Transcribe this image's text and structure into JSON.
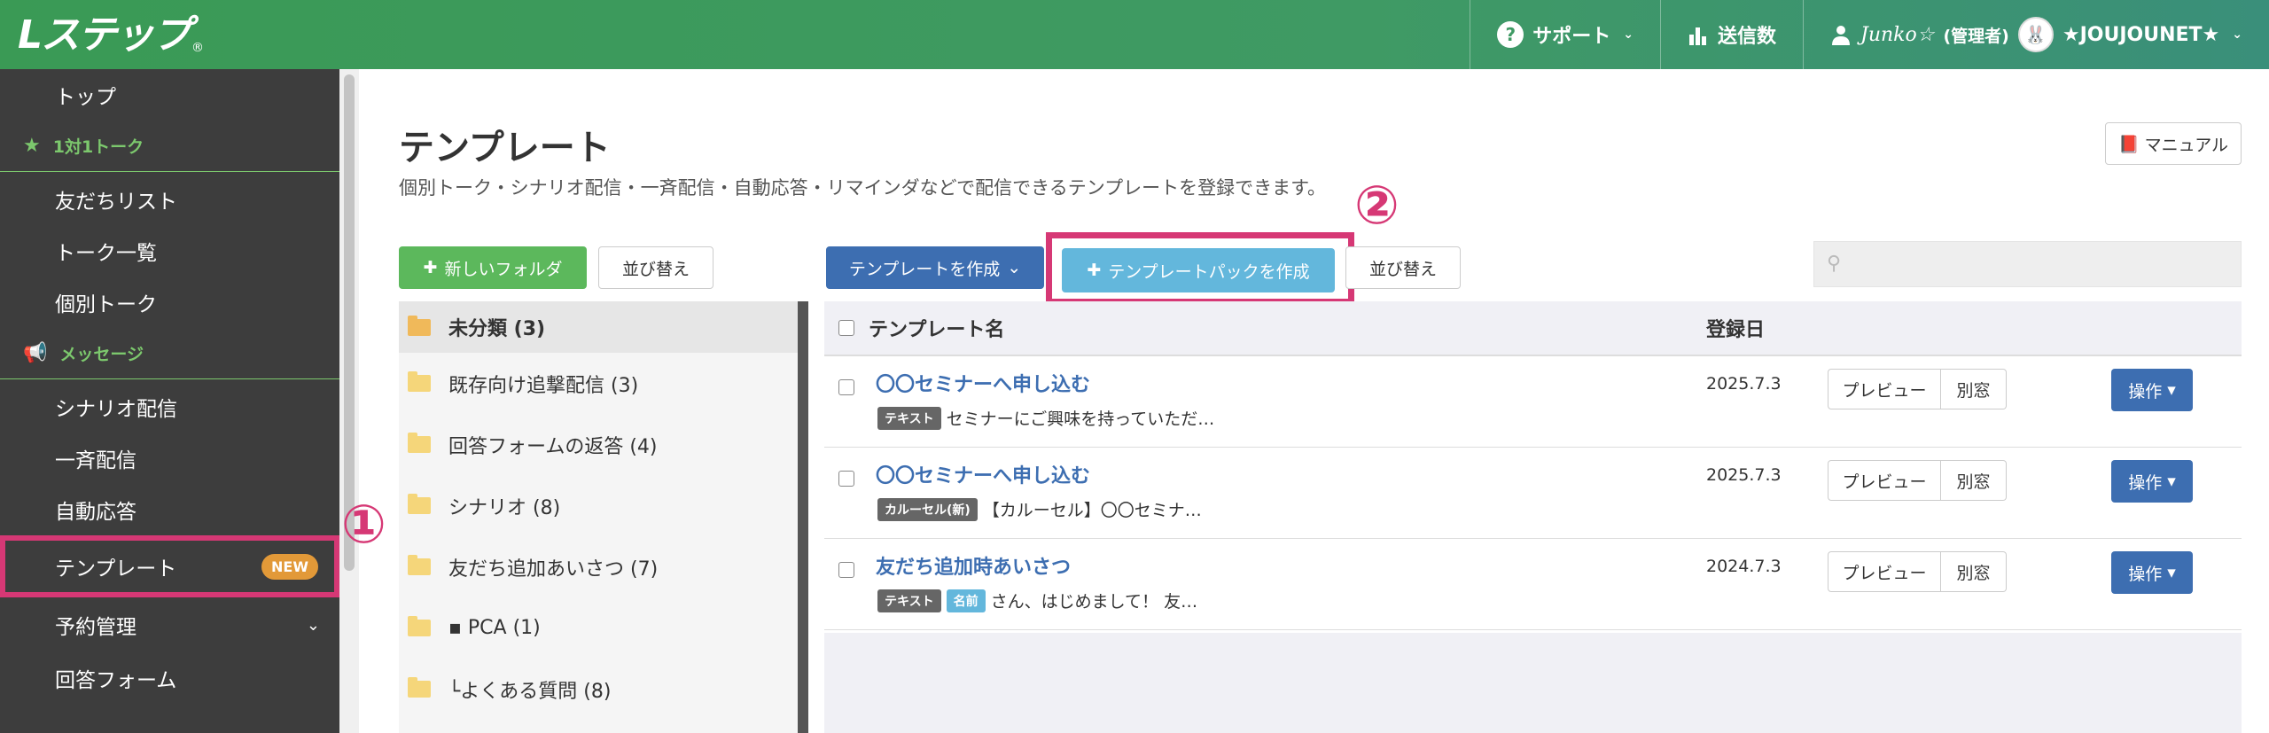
{
  "header": {
    "logo_text": "Lステップ",
    "support_label": "サポート",
    "sent_count_label": "送信数",
    "user_name": "Junko☆",
    "user_role": "(管理者)",
    "account_name": "★JOUJOUNET★"
  },
  "sidebar": {
    "items": [
      {
        "label": "トップ"
      },
      {
        "section": "1対1トーク"
      },
      {
        "label": "友だちリスト"
      },
      {
        "label": "トーク一覧"
      },
      {
        "label": "個別トーク"
      },
      {
        "section": "メッセージ"
      },
      {
        "label": "シナリオ配信"
      },
      {
        "label": "一斉配信"
      },
      {
        "label": "自動応答"
      },
      {
        "label": "テンプレート",
        "badge": "NEW"
      },
      {
        "label": "予約管理"
      },
      {
        "label": "回答フォーム"
      }
    ]
  },
  "annotations": {
    "one": "①",
    "two": "②"
  },
  "main": {
    "title": "テンプレート",
    "description": "個別トーク・シナリオ配信・一斉配信・自動応答・リマインダなどで配信できるテンプレートを登録できます。",
    "manual_label": "マニュアル",
    "new_folder_label": "新しいフォルダ",
    "sort_label": "並び替え",
    "create_template_label": "テンプレートを作成",
    "create_pack_label": "テンプレートパックを作成",
    "sort_label_2": "並び替え"
  },
  "folders": [
    {
      "name": "未分類 (3)"
    },
    {
      "name": "既存向け追撃配信 (3)"
    },
    {
      "name": "回答フォームの返答 (4)"
    },
    {
      "name": "シナリオ (8)"
    },
    {
      "name": "友だち追加あいさつ (7)"
    },
    {
      "name": "▪ PCA (1)"
    },
    {
      "name": "└よくある質問 (8)"
    }
  ],
  "table": {
    "col_name": "テンプレート名",
    "col_date": "登録日",
    "preview_label": "プレビュー",
    "window_label": "別窓",
    "operation_label": "操作",
    "rows": [
      {
        "title": "〇〇セミナーへ申し込む",
        "tag": "テキスト",
        "tag2": "",
        "excerpt": "セミナーにご興味を持っていただ…",
        "date": "2025.7.3"
      },
      {
        "title": "〇〇セミナーへ申し込む",
        "tag": "カルーセル(新)",
        "tag2": "",
        "excerpt": "【カルーセル】〇〇セミナ…",
        "date": "2025.7.3"
      },
      {
        "title": "友だち追加時あいさつ",
        "tag": "テキスト",
        "tag2": "名前",
        "excerpt": "さん、はじめまして！ 友…",
        "date": "2024.7.3"
      }
    ]
  },
  "colors": {
    "header_green": "#3f9a64",
    "highlight_pink": "#d63875",
    "primary_blue": "#3d6eb1",
    "light_blue": "#63b7dc",
    "green_button": "#5cb85c"
  }
}
